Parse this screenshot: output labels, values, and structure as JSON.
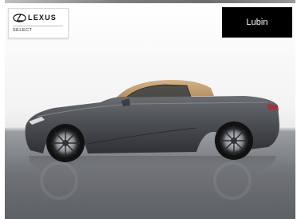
{
  "dealer_badge": {
    "brand": "LEXUS",
    "subtitle": "SELECT"
  },
  "location_button": {
    "label": "Lubin"
  },
  "car_image": {
    "subject": "lexus-lc-convertible-side-view",
    "body_color": "#4e5156",
    "roof_color": "#c9a57a"
  }
}
